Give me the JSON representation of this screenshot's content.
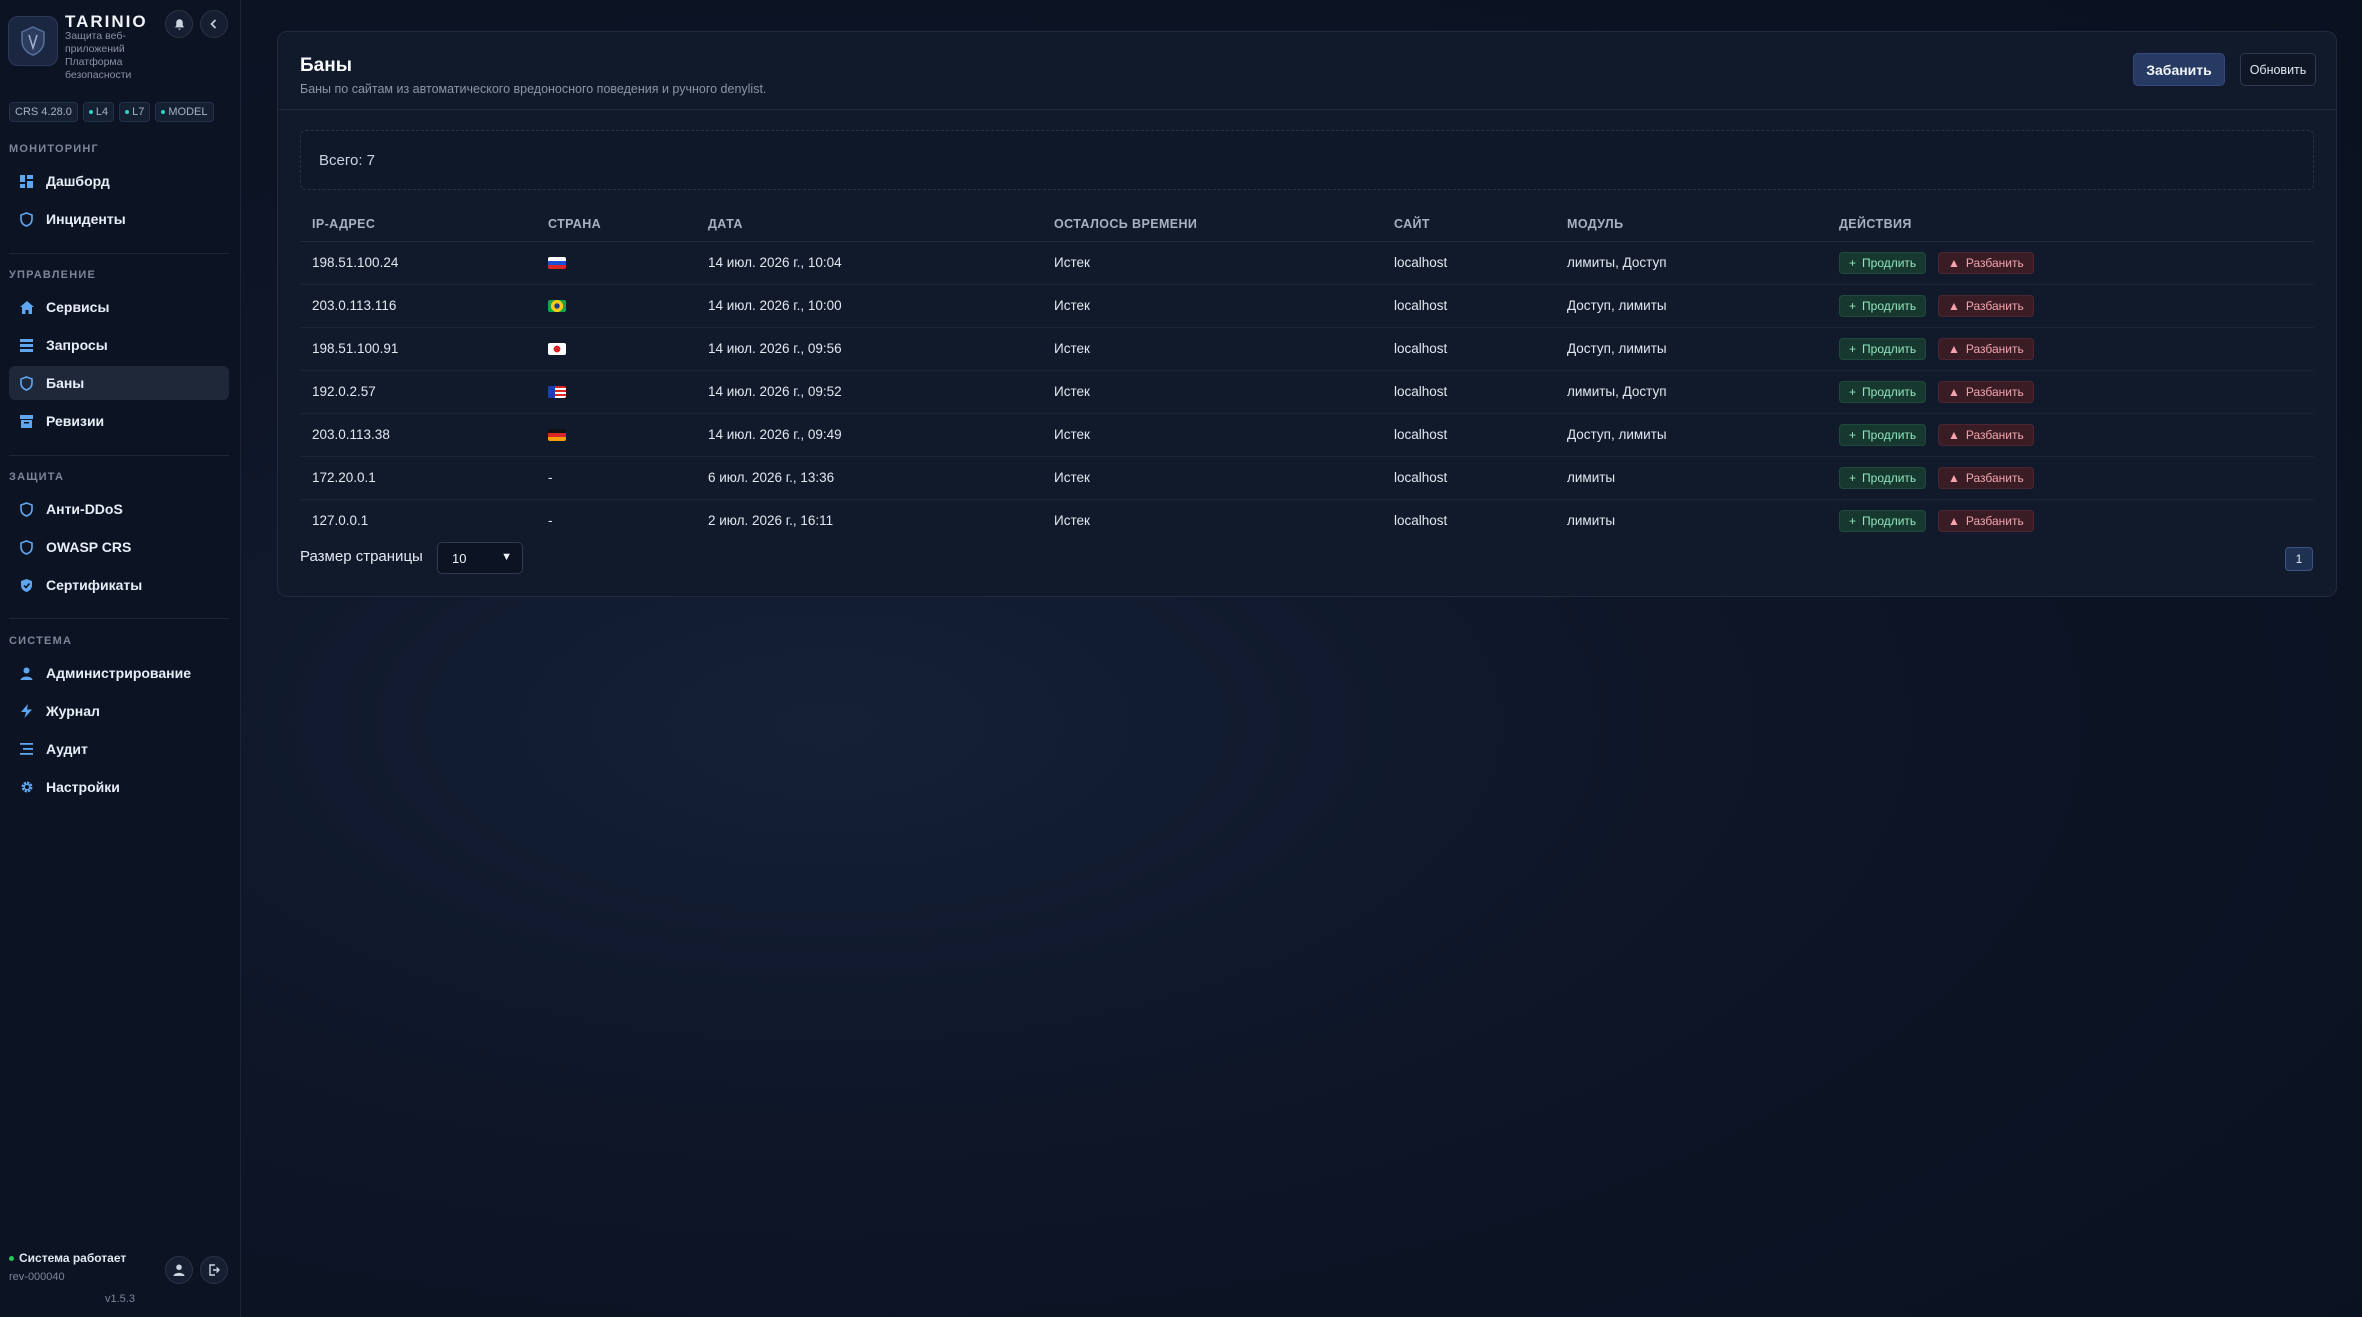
{
  "sidebar": {
    "brand": {
      "title": "TARINIO",
      "subtitle": "Защита веб-приложений Платформа безопасности"
    },
    "badges": [
      {
        "label": "CRS 4.28.0"
      },
      {
        "label": "L4"
      },
      {
        "label": "L7"
      },
      {
        "label": "MODEL"
      }
    ],
    "sections": [
      {
        "title": "МОНИТОРИНГ",
        "items": [
          {
            "label": "Дашборд",
            "icon": "dashboard-icon"
          },
          {
            "label": "Инциденты",
            "icon": "shield-icon"
          }
        ]
      },
      {
        "title": "УПРАВЛЕНИЕ",
        "items": [
          {
            "label": "Сервисы",
            "icon": "home-icon"
          },
          {
            "label": "Запросы",
            "icon": "list-icon"
          },
          {
            "label": "Баны",
            "icon": "shield-icon",
            "active": true
          },
          {
            "label": "Ревизии",
            "icon": "archive-icon"
          }
        ]
      },
      {
        "title": "ЗАЩИТА",
        "items": [
          {
            "label": "Анти-DDoS",
            "icon": "shield-icon"
          },
          {
            "label": "OWASP CRS",
            "icon": "shield-icon"
          },
          {
            "label": "Сертификаты",
            "icon": "shield-check-icon"
          }
        ]
      },
      {
        "title": "СИСТЕМА",
        "items": [
          {
            "label": "Администрирование",
            "icon": "user-icon"
          },
          {
            "label": "Журнал",
            "icon": "bolt-icon"
          },
          {
            "label": "Аудит",
            "icon": "lines-icon"
          },
          {
            "label": "Настройки",
            "icon": "gear-icon"
          }
        ]
      }
    ],
    "status": "Система работает",
    "revision": "rev-000040",
    "version": "v1.5.3"
  },
  "header": {
    "title": "Баны",
    "subtitle": "Баны по сайтам из автоматического вредоносного поведения и ручного denylist.",
    "ban_button": "Забанить",
    "refresh_button": "Обновить"
  },
  "summary": {
    "total": "Всего: 7"
  },
  "table": {
    "columns": [
      "IP-АДРЕС",
      "СТРАНА",
      "ДАТА",
      "ОСТАЛОСЬ ВРЕМЕНИ",
      "САЙТ",
      "МОДУЛЬ",
      "ДЕЙСТВИЯ"
    ],
    "rows": [
      {
        "ip": "198.51.100.24",
        "country": "RU",
        "date": "14 июл. 2026 г., 10:04",
        "remaining": "Истек",
        "site": "localhost",
        "module": "лимиты, Доступ"
      },
      {
        "ip": "203.0.113.116",
        "country": "BR",
        "date": "14 июл. 2026 г., 10:00",
        "remaining": "Истек",
        "site": "localhost",
        "module": "Доступ, лимиты"
      },
      {
        "ip": "198.51.100.91",
        "country": "JP",
        "date": "14 июл. 2026 г., 09:56",
        "remaining": "Истек",
        "site": "localhost",
        "module": "Доступ, лимиты"
      },
      {
        "ip": "192.0.2.57",
        "country": "US",
        "date": "14 июл. 2026 г., 09:52",
        "remaining": "Истек",
        "site": "localhost",
        "module": "лимиты, Доступ"
      },
      {
        "ip": "203.0.113.38",
        "country": "DE",
        "date": "14 июл. 2026 г., 09:49",
        "remaining": "Истек",
        "site": "localhost",
        "module": "Доступ, лимиты"
      },
      {
        "ip": "172.20.0.1",
        "country": "-",
        "date": "6 июл. 2026 г., 13:36",
        "remaining": "Истек",
        "site": "localhost",
        "module": "лимиты"
      },
      {
        "ip": "127.0.0.1",
        "country": "-",
        "date": "2 июл. 2026 г., 16:11",
        "remaining": "Истек",
        "site": "localhost",
        "module": "лимиты"
      }
    ],
    "extend_label": "Продлить",
    "unban_label": "Разбанить"
  },
  "pagination": {
    "page_size_label": "Размер страницы",
    "page_size": "10",
    "current_page": "1"
  },
  "colors": {
    "accent": "#5fa6f0",
    "extend": "#8fe6bf",
    "unban": "#f5a3ae",
    "status_ok": "#22c55e"
  }
}
